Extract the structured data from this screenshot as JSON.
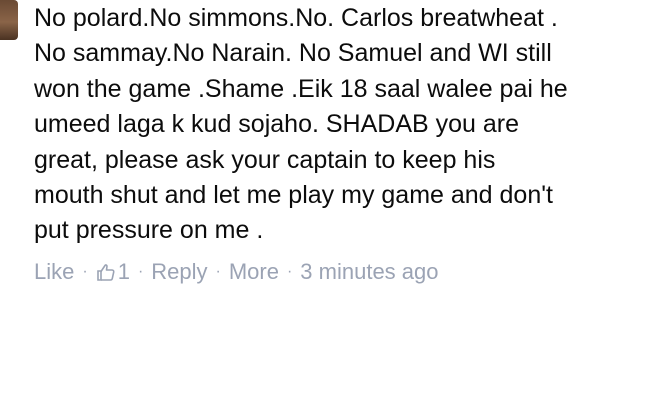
{
  "comment": {
    "lines": [
      "No polard.No simmons.No. Carlos breatwheat .",
      "No sammay.No Narain. No Samuel and WI still",
      "won the game .Shame .Eik 18 saal walee pai he",
      "umeed laga k kud sojaho. SHADAB you are",
      "great, please ask your captain to keep his",
      "mouth shut and let me play my game and don't",
      "put pressure on me ."
    ]
  },
  "actions": {
    "like_label": "Like",
    "like_count": "1",
    "reply_label": "Reply",
    "more_label": "More",
    "timestamp": "3 minutes ago",
    "separator": "·",
    "like_icon": "thumbs-up-icon"
  },
  "colors": {
    "text": "#0c0c0c",
    "meta": "#9ba3b4"
  }
}
